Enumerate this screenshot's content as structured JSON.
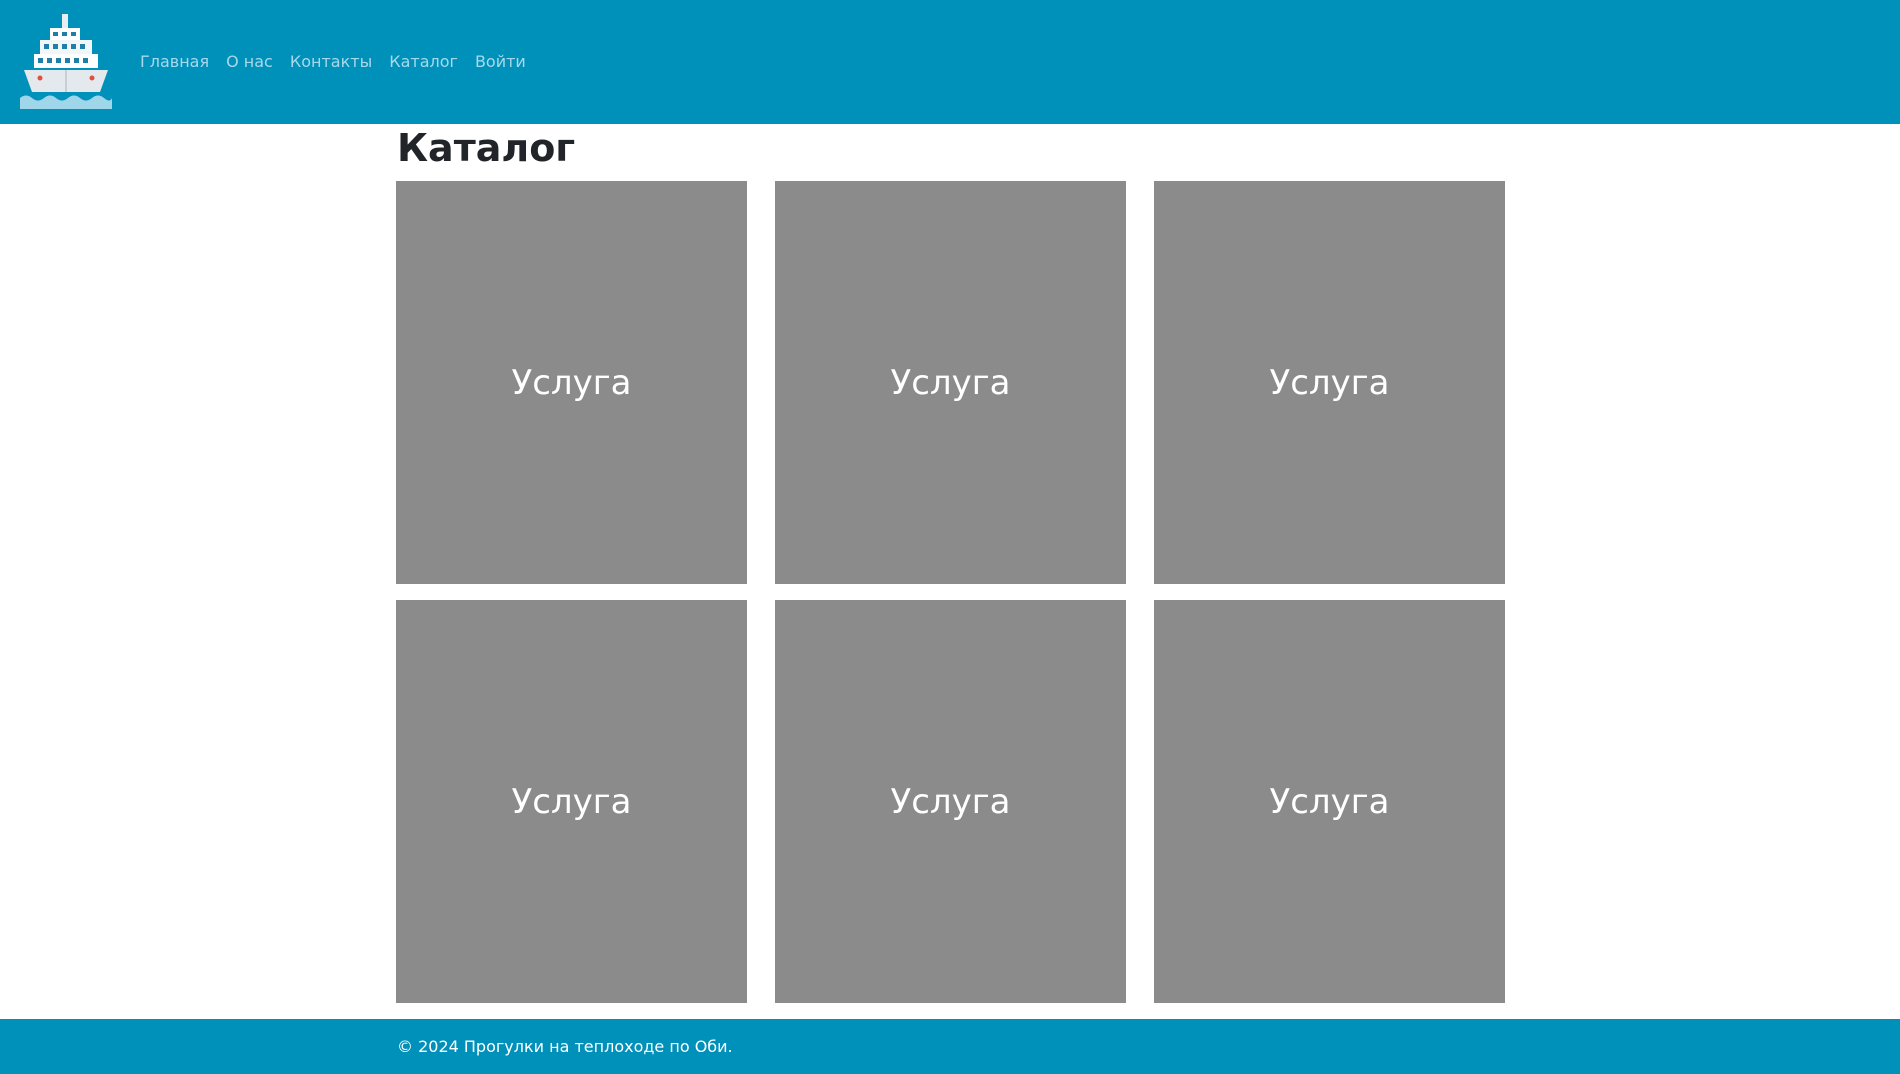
{
  "header": {
    "nav": [
      {
        "label": "Главная"
      },
      {
        "label": "О нас"
      },
      {
        "label": "Контакты"
      },
      {
        "label": "Каталог"
      },
      {
        "label": "Войти"
      }
    ]
  },
  "main": {
    "title": "Каталог",
    "cards": [
      {
        "label": "Услуга"
      },
      {
        "label": "Услуга"
      },
      {
        "label": "Услуга"
      },
      {
        "label": "Услуга"
      },
      {
        "label": "Услуга"
      },
      {
        "label": "Услуга"
      }
    ]
  },
  "footer": {
    "text": "© 2024 Прогулки на теплоходе по Оби."
  },
  "colors": {
    "brand": "#0091bb",
    "nav_link": "#a9d8ea",
    "card_placeholder": "#8b8b8b"
  },
  "icons": {
    "logo": "ship-icon"
  }
}
